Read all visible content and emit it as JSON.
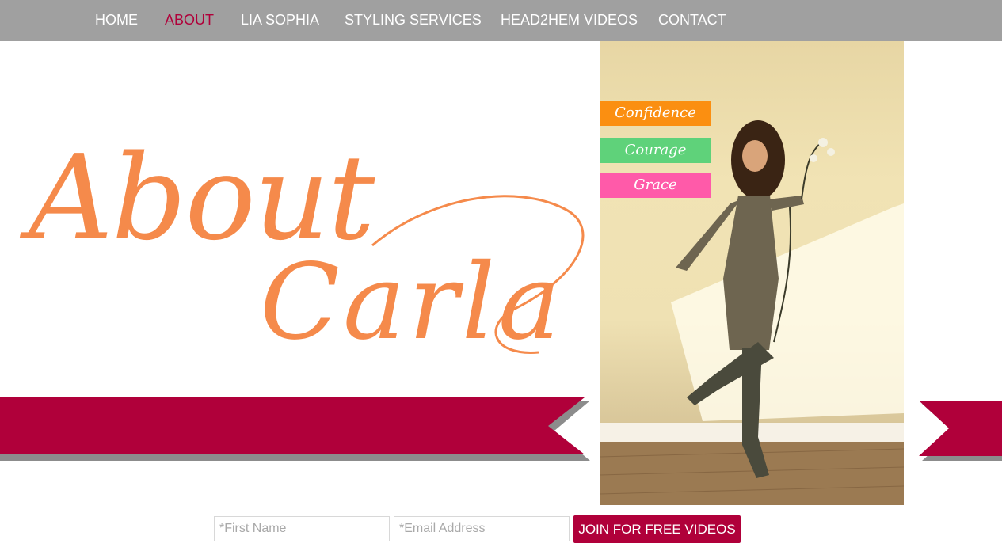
{
  "nav": {
    "items": [
      {
        "label": "HOME",
        "active": false
      },
      {
        "label": "ABOUT",
        "active": true
      },
      {
        "label": "LIA SOPHIA",
        "active": false
      },
      {
        "label": "STYLING SERVICES",
        "active": false
      },
      {
        "label": "HEAD2HEM VIDEOS",
        "active": false
      },
      {
        "label": "CONTACT",
        "active": false
      }
    ]
  },
  "headline": {
    "line1": "About",
    "line2": "Carla"
  },
  "tags": [
    {
      "label": "Confidence",
      "color": "#fb8f11"
    },
    {
      "label": "Courage",
      "color": "#5fd27a"
    },
    {
      "label": "Grace",
      "color": "#ff5aa9"
    }
  ],
  "form": {
    "first_name_placeholder": "*First Name",
    "email_placeholder": "*Email Address",
    "button_label": "JOIN FOR FREE VIDEOS"
  },
  "colors": {
    "nav_bg": "#a0a0a0",
    "accent": "#b0003a",
    "headline": "#f58a4b"
  }
}
